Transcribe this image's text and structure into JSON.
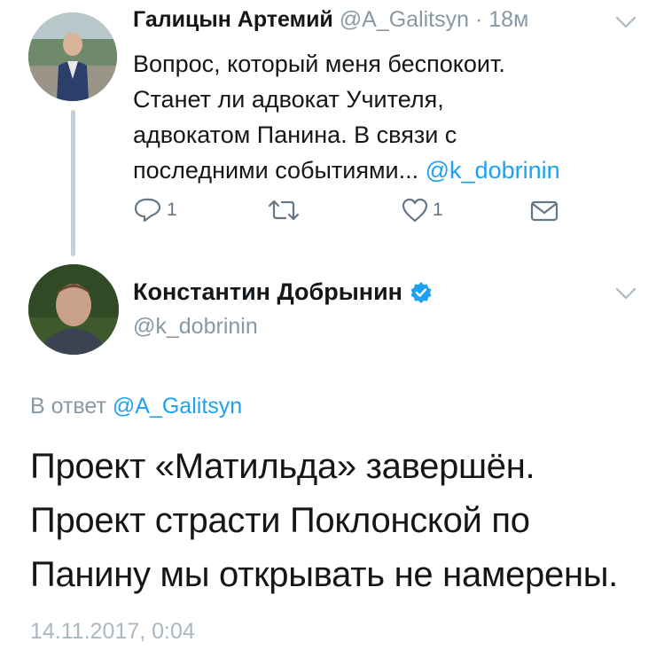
{
  "tweet1": {
    "author_name": "Галицын Артемий",
    "handle": "@A_Galitsyn",
    "separator": "·",
    "time": "18м",
    "text_lines": [
      "Вопрос, который меня беспокоит.",
      "Станет ли адвокат Учителя,",
      "адвокатом Панина.  В связи с",
      "последними событиями... "
    ],
    "mention": "@k_dobrinin",
    "actions": {
      "reply_count": "1",
      "retweet_count": "",
      "like_count": "1"
    },
    "icons": [
      "reply-icon",
      "retweet-icon",
      "like-icon",
      "message-icon",
      "chevron-down-icon"
    ]
  },
  "tweet2": {
    "author_name": "Константин Добрынин",
    "verified": true,
    "handle": "@k_dobrinin",
    "reply_prefix": "В ответ ",
    "reply_to": "@A_Galitsyn",
    "text_lines": [
      "Проект «Матильда» завершён.",
      "Проект страсти Поклонской по",
      "Панину мы открывать не намерены."
    ],
    "timestamp": "14.11.2017, 0:04"
  },
  "colors": {
    "link": "#1da1f2",
    "muted": "#8899a6",
    "text": "#14171a",
    "verified": "#1da1f2",
    "thread_line": "#c4cfd6"
  }
}
